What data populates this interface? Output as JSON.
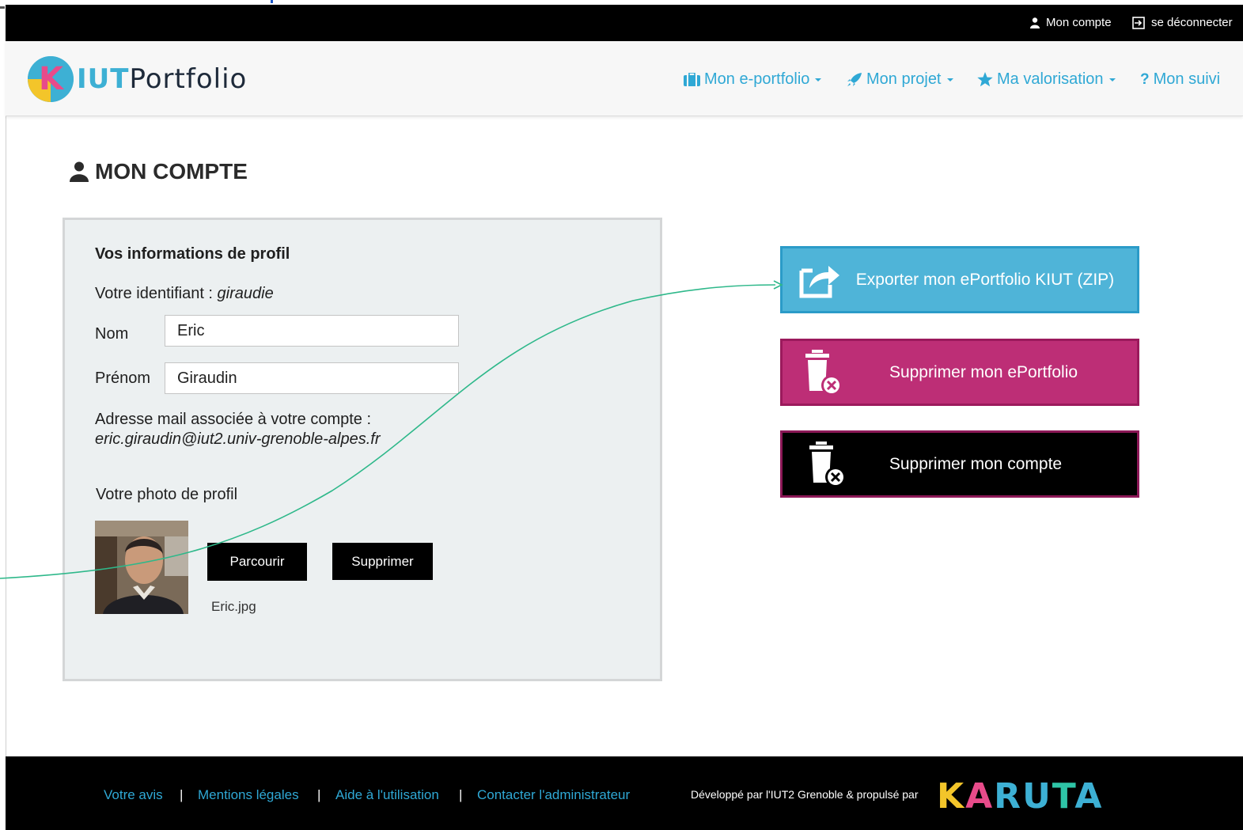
{
  "topbar": {
    "account_label": "Mon compte",
    "logout_label": "se déconnecter"
  },
  "logo": {
    "k": "K",
    "iut": "IUT",
    "rest": "Portfolio"
  },
  "nav": {
    "eportfolio": "Mon e-portfolio",
    "projet": "Mon projet",
    "valorisation": "Ma valorisation",
    "suivi": "Mon suivi"
  },
  "page": {
    "title": "MON COMPTE"
  },
  "profile": {
    "section_title": "Vos informations de profil",
    "identifier_label": "Votre identifiant : ",
    "identifier_value": "giraudie",
    "nom_label": "Nom",
    "nom_value": "Eric",
    "prenom_label": "Prénom",
    "prenom_value": "Giraudin",
    "mail_label": "Adresse mail associée à votre compte :",
    "mail_value": "eric.giraudin@iut2.univ-grenoble-alpes.fr",
    "photo_label": "Votre photo de profil",
    "browse_button": "Parcourir",
    "delete_button": "Supprimer",
    "filename": "Eric.jpg"
  },
  "actions": {
    "export": "Exporter mon ePortfolio KIUT (ZIP)",
    "delete_portfolio": "Supprimer mon ePortfolio",
    "delete_account": "Supprimer mon compte"
  },
  "footer": {
    "links": [
      "Votre avis",
      "Mentions légales",
      "Aide à l'utilisation",
      "Contacter l'administrateur"
    ],
    "separator": "|",
    "developed_by": "Développé par l'IUT2 Grenoble & propulsé par",
    "brand": "KARUTA"
  },
  "colors": {
    "accent_blue": "#2fa8d5",
    "export_bg": "#4fb4d8",
    "magenta": "#bd2e76",
    "annotation_line": "#2eb88a"
  }
}
